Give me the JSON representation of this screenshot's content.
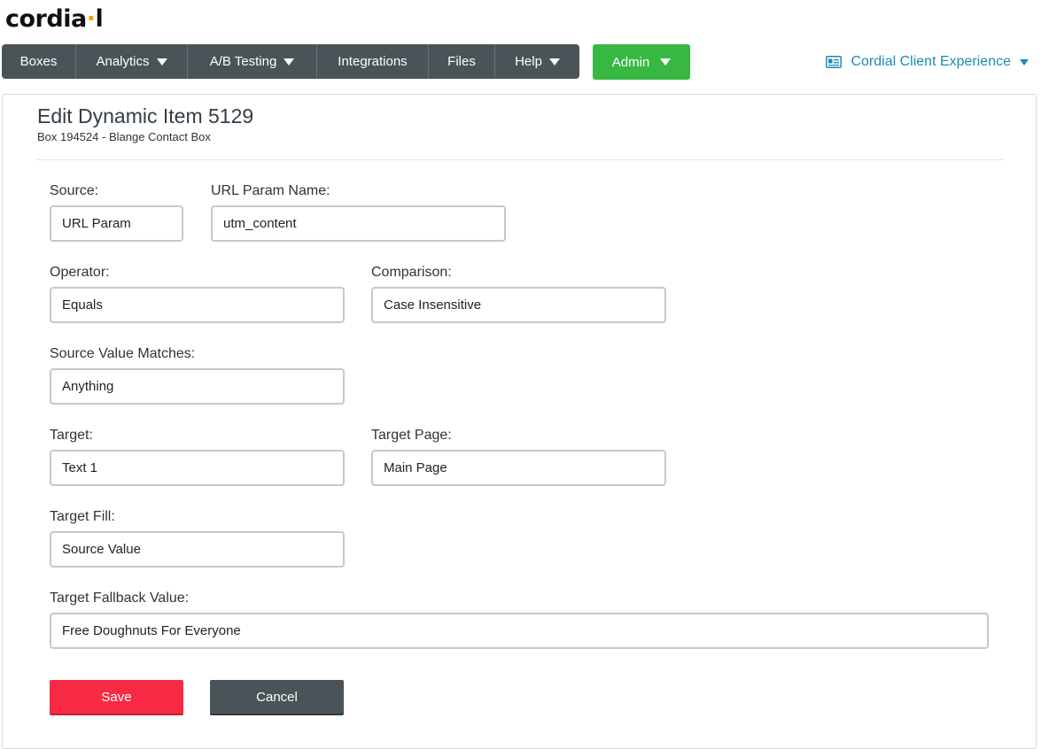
{
  "logo": {
    "text_before": "cordia",
    "text_after": "l"
  },
  "nav": {
    "items": [
      {
        "label": "Boxes"
      },
      {
        "label": "Analytics"
      },
      {
        "label": "A/B Testing"
      },
      {
        "label": "Integrations"
      },
      {
        "label": "Files"
      },
      {
        "label": "Help"
      }
    ],
    "admin_label": "Admin",
    "client_label": "Cordial Client Experience"
  },
  "page": {
    "title": "Edit Dynamic Item 5129",
    "subtitle": "Box 194524 - Blange Contact Box"
  },
  "form": {
    "source": {
      "label": "Source:",
      "value": "URL Param"
    },
    "url_param_name": {
      "label": "URL Param Name:",
      "value": "utm_content"
    },
    "operator": {
      "label": "Operator:",
      "value": "Equals"
    },
    "comparison": {
      "label": "Comparison:",
      "value": "Case Insensitive"
    },
    "source_value_matches": {
      "label": "Source Value Matches:",
      "value": "Anything"
    },
    "target": {
      "label": "Target:",
      "value": "Text 1"
    },
    "target_page": {
      "label": "Target Page:",
      "value": "Main Page"
    },
    "target_fill": {
      "label": "Target Fill:",
      "value": "Source Value"
    },
    "target_fallback_value": {
      "label": "Target Fallback Value:",
      "value": "Free Doughnuts For Everyone"
    }
  },
  "actions": {
    "save_label": "Save",
    "cancel_label": "Cancel"
  },
  "colors": {
    "nav_bg": "#4a5358",
    "admin_green": "#38b843",
    "link_blue": "#1a8ab5",
    "save_red": "#f72a43",
    "logo_accent": "#f0a500"
  },
  "icons": {
    "client": "contact-card-icon",
    "dropdown": "chevron-down-icon"
  }
}
